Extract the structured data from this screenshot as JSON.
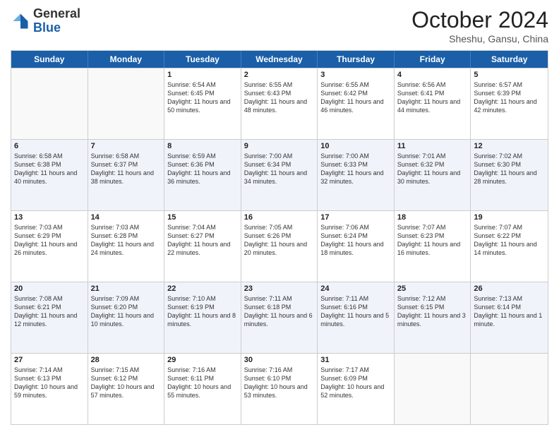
{
  "header": {
    "logo_general": "General",
    "logo_blue": "Blue",
    "month_title": "October 2024",
    "subtitle": "Sheshu, Gansu, China"
  },
  "calendar": {
    "days_of_week": [
      "Sunday",
      "Monday",
      "Tuesday",
      "Wednesday",
      "Thursday",
      "Friday",
      "Saturday"
    ],
    "rows": [
      [
        {
          "day": "",
          "sunrise": "",
          "sunset": "",
          "daylight": "",
          "empty": true
        },
        {
          "day": "",
          "sunrise": "",
          "sunset": "",
          "daylight": "",
          "empty": true
        },
        {
          "day": "1",
          "sunrise": "Sunrise: 6:54 AM",
          "sunset": "Sunset: 6:45 PM",
          "daylight": "Daylight: 11 hours and 50 minutes.",
          "empty": false
        },
        {
          "day": "2",
          "sunrise": "Sunrise: 6:55 AM",
          "sunset": "Sunset: 6:43 PM",
          "daylight": "Daylight: 11 hours and 48 minutes.",
          "empty": false
        },
        {
          "day": "3",
          "sunrise": "Sunrise: 6:55 AM",
          "sunset": "Sunset: 6:42 PM",
          "daylight": "Daylight: 11 hours and 46 minutes.",
          "empty": false
        },
        {
          "day": "4",
          "sunrise": "Sunrise: 6:56 AM",
          "sunset": "Sunset: 6:41 PM",
          "daylight": "Daylight: 11 hours and 44 minutes.",
          "empty": false
        },
        {
          "day": "5",
          "sunrise": "Sunrise: 6:57 AM",
          "sunset": "Sunset: 6:39 PM",
          "daylight": "Daylight: 11 hours and 42 minutes.",
          "empty": false
        }
      ],
      [
        {
          "day": "6",
          "sunrise": "Sunrise: 6:58 AM",
          "sunset": "Sunset: 6:38 PM",
          "daylight": "Daylight: 11 hours and 40 minutes.",
          "empty": false
        },
        {
          "day": "7",
          "sunrise": "Sunrise: 6:58 AM",
          "sunset": "Sunset: 6:37 PM",
          "daylight": "Daylight: 11 hours and 38 minutes.",
          "empty": false
        },
        {
          "day": "8",
          "sunrise": "Sunrise: 6:59 AM",
          "sunset": "Sunset: 6:36 PM",
          "daylight": "Daylight: 11 hours and 36 minutes.",
          "empty": false
        },
        {
          "day": "9",
          "sunrise": "Sunrise: 7:00 AM",
          "sunset": "Sunset: 6:34 PM",
          "daylight": "Daylight: 11 hours and 34 minutes.",
          "empty": false
        },
        {
          "day": "10",
          "sunrise": "Sunrise: 7:00 AM",
          "sunset": "Sunset: 6:33 PM",
          "daylight": "Daylight: 11 hours and 32 minutes.",
          "empty": false
        },
        {
          "day": "11",
          "sunrise": "Sunrise: 7:01 AM",
          "sunset": "Sunset: 6:32 PM",
          "daylight": "Daylight: 11 hours and 30 minutes.",
          "empty": false
        },
        {
          "day": "12",
          "sunrise": "Sunrise: 7:02 AM",
          "sunset": "Sunset: 6:30 PM",
          "daylight": "Daylight: 11 hours and 28 minutes.",
          "empty": false
        }
      ],
      [
        {
          "day": "13",
          "sunrise": "Sunrise: 7:03 AM",
          "sunset": "Sunset: 6:29 PM",
          "daylight": "Daylight: 11 hours and 26 minutes.",
          "empty": false
        },
        {
          "day": "14",
          "sunrise": "Sunrise: 7:03 AM",
          "sunset": "Sunset: 6:28 PM",
          "daylight": "Daylight: 11 hours and 24 minutes.",
          "empty": false
        },
        {
          "day": "15",
          "sunrise": "Sunrise: 7:04 AM",
          "sunset": "Sunset: 6:27 PM",
          "daylight": "Daylight: 11 hours and 22 minutes.",
          "empty": false
        },
        {
          "day": "16",
          "sunrise": "Sunrise: 7:05 AM",
          "sunset": "Sunset: 6:26 PM",
          "daylight": "Daylight: 11 hours and 20 minutes.",
          "empty": false
        },
        {
          "day": "17",
          "sunrise": "Sunrise: 7:06 AM",
          "sunset": "Sunset: 6:24 PM",
          "daylight": "Daylight: 11 hours and 18 minutes.",
          "empty": false
        },
        {
          "day": "18",
          "sunrise": "Sunrise: 7:07 AM",
          "sunset": "Sunset: 6:23 PM",
          "daylight": "Daylight: 11 hours and 16 minutes.",
          "empty": false
        },
        {
          "day": "19",
          "sunrise": "Sunrise: 7:07 AM",
          "sunset": "Sunset: 6:22 PM",
          "daylight": "Daylight: 11 hours and 14 minutes.",
          "empty": false
        }
      ],
      [
        {
          "day": "20",
          "sunrise": "Sunrise: 7:08 AM",
          "sunset": "Sunset: 6:21 PM",
          "daylight": "Daylight: 11 hours and 12 minutes.",
          "empty": false
        },
        {
          "day": "21",
          "sunrise": "Sunrise: 7:09 AM",
          "sunset": "Sunset: 6:20 PM",
          "daylight": "Daylight: 11 hours and 10 minutes.",
          "empty": false
        },
        {
          "day": "22",
          "sunrise": "Sunrise: 7:10 AM",
          "sunset": "Sunset: 6:19 PM",
          "daylight": "Daylight: 11 hours and 8 minutes.",
          "empty": false
        },
        {
          "day": "23",
          "sunrise": "Sunrise: 7:11 AM",
          "sunset": "Sunset: 6:18 PM",
          "daylight": "Daylight: 11 hours and 6 minutes.",
          "empty": false
        },
        {
          "day": "24",
          "sunrise": "Sunrise: 7:11 AM",
          "sunset": "Sunset: 6:16 PM",
          "daylight": "Daylight: 11 hours and 5 minutes.",
          "empty": false
        },
        {
          "day": "25",
          "sunrise": "Sunrise: 7:12 AM",
          "sunset": "Sunset: 6:15 PM",
          "daylight": "Daylight: 11 hours and 3 minutes.",
          "empty": false
        },
        {
          "day": "26",
          "sunrise": "Sunrise: 7:13 AM",
          "sunset": "Sunset: 6:14 PM",
          "daylight": "Daylight: 11 hours and 1 minute.",
          "empty": false
        }
      ],
      [
        {
          "day": "27",
          "sunrise": "Sunrise: 7:14 AM",
          "sunset": "Sunset: 6:13 PM",
          "daylight": "Daylight: 10 hours and 59 minutes.",
          "empty": false
        },
        {
          "day": "28",
          "sunrise": "Sunrise: 7:15 AM",
          "sunset": "Sunset: 6:12 PM",
          "daylight": "Daylight: 10 hours and 57 minutes.",
          "empty": false
        },
        {
          "day": "29",
          "sunrise": "Sunrise: 7:16 AM",
          "sunset": "Sunset: 6:11 PM",
          "daylight": "Daylight: 10 hours and 55 minutes.",
          "empty": false
        },
        {
          "day": "30",
          "sunrise": "Sunrise: 7:16 AM",
          "sunset": "Sunset: 6:10 PM",
          "daylight": "Daylight: 10 hours and 53 minutes.",
          "empty": false
        },
        {
          "day": "31",
          "sunrise": "Sunrise: 7:17 AM",
          "sunset": "Sunset: 6:09 PM",
          "daylight": "Daylight: 10 hours and 52 minutes.",
          "empty": false
        },
        {
          "day": "",
          "sunrise": "",
          "sunset": "",
          "daylight": "",
          "empty": true
        },
        {
          "day": "",
          "sunrise": "",
          "sunset": "",
          "daylight": "",
          "empty": true
        }
      ]
    ]
  }
}
